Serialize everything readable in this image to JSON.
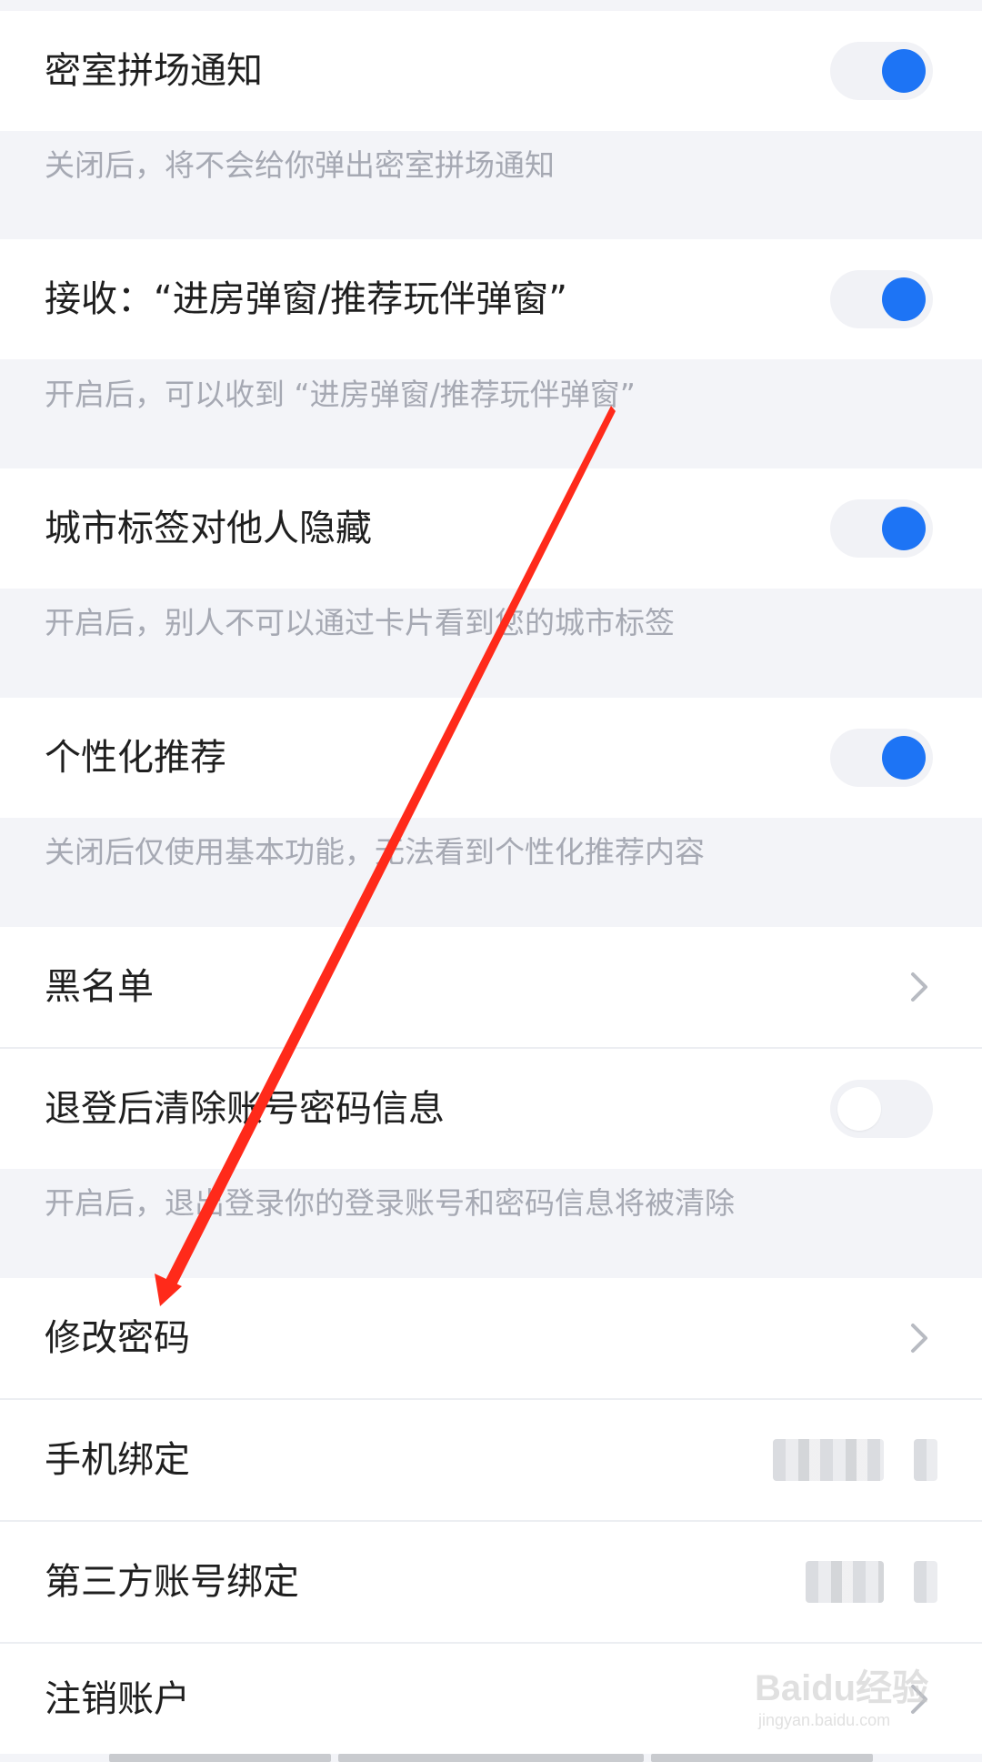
{
  "settings": {
    "room_notify": {
      "label": "密室拼场通知",
      "desc": "关闭后，将不会给你弹出密室拼场通知",
      "enabled": true
    },
    "receive_popups": {
      "label": "接收：“进房弹窗/推荐玩伴弹窗”",
      "desc": "开启后，可以收到 “进房弹窗/推荐玩伴弹窗”",
      "enabled": true
    },
    "hide_city": {
      "label": "城市标签对他人隐藏",
      "desc": "开启后，别人不可以通过卡片看到您的城市标签",
      "enabled": true
    },
    "personalized": {
      "label": "个性化推荐",
      "desc": "关闭后仅使用基本功能，无法看到个性化推荐内容",
      "enabled": true
    },
    "blacklist": {
      "label": "黑名单"
    },
    "clear_on_logout": {
      "label": "退登后清除账号密码信息",
      "desc": "开启后，退出登录你的登录账号和密码信息将被清除",
      "enabled": false
    },
    "change_password": {
      "label": "修改密码"
    },
    "phone_binding": {
      "label": "手机绑定"
    },
    "third_party_binding": {
      "label": "第三方账号绑定"
    },
    "delete_account": {
      "label": "注销账户"
    }
  },
  "icons": {
    "chevron": "chevron-right-icon"
  },
  "colors": {
    "toggle_on": "#1d74f5",
    "toggle_track": "#f1f2f6",
    "annotation_arrow": "#ff2a1a",
    "page_bg": "#f3f4f8"
  },
  "watermark": {
    "brand": "Baidu经验",
    "url": "jingyan.baidu.com"
  }
}
